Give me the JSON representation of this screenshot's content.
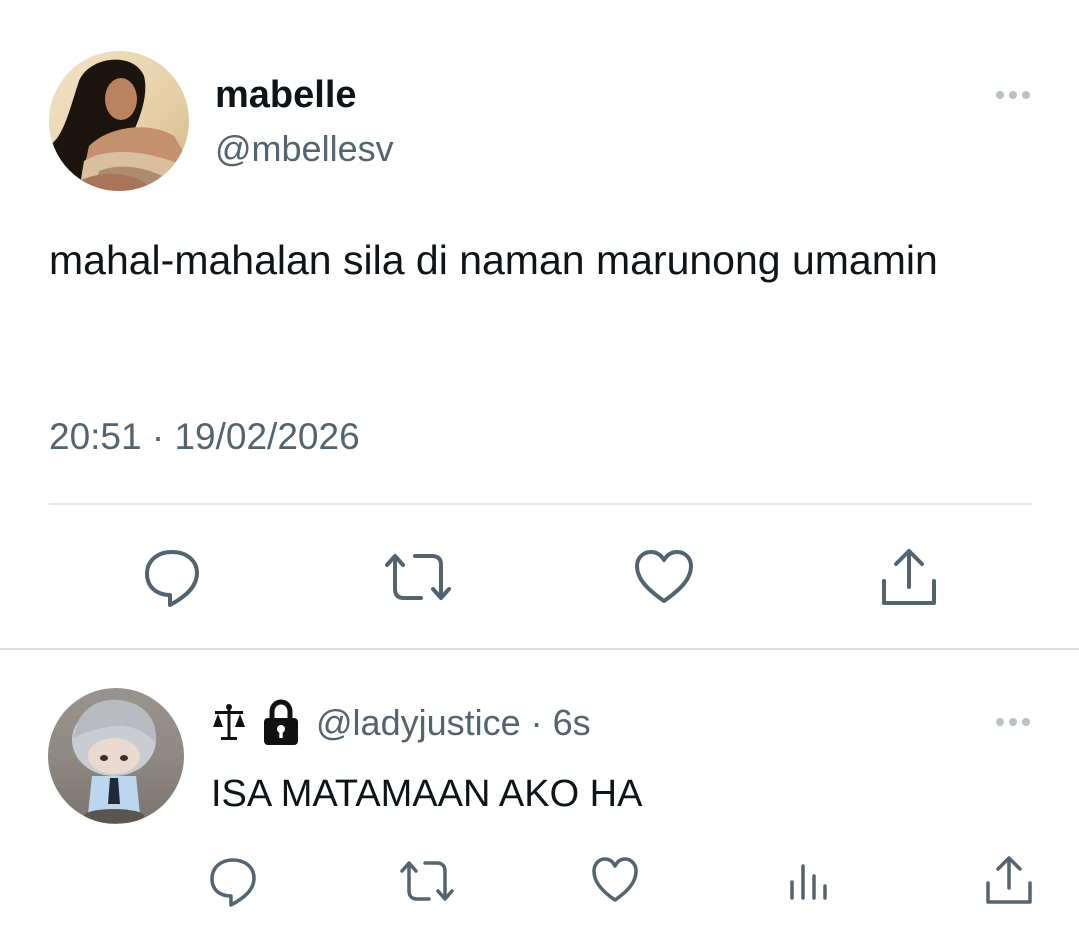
{
  "tweet": {
    "display_name": "mabelle",
    "handle": "@mbellesv",
    "text": "mahal-mahalan sila di naman marunong umamin",
    "timestamp": "20:51 · 19/02/2026"
  },
  "reply": {
    "handle_line": "@ladyjustice · 6s",
    "text": "ISA MATAMAAN AKO HA",
    "name_emoji": "scales-icon",
    "protected": "lock-icon"
  },
  "colors": {
    "primary_text": "#0f1419",
    "secondary_text": "#536471",
    "icon": "#536471",
    "divider": "#e6e9eb",
    "more_dots": "#b9c0c6"
  },
  "icons": {
    "reply": "speech-bubble-icon",
    "retweet": "retweet-icon",
    "like": "heart-icon",
    "share": "share-icon",
    "stats": "bar-chart-icon",
    "more": "more-dots-icon"
  }
}
